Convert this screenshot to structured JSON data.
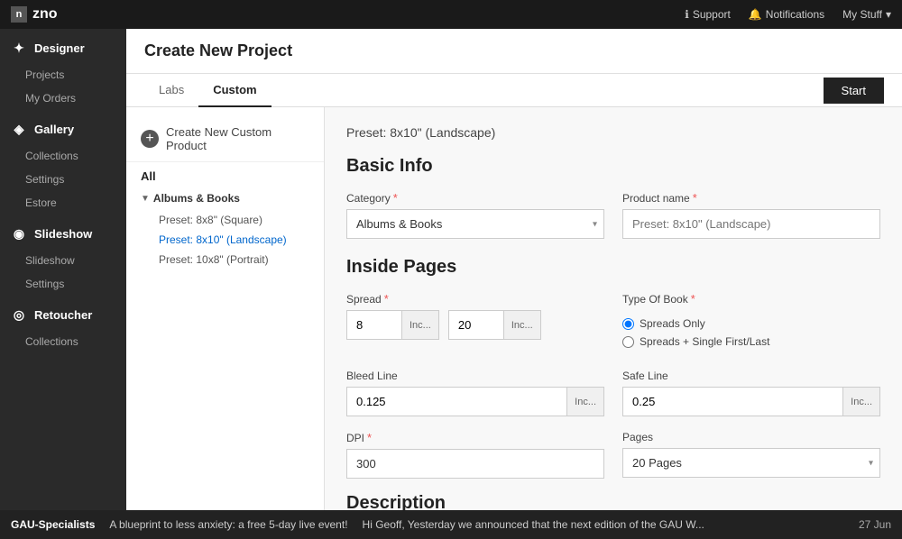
{
  "app": {
    "logo": "zno",
    "logo_prefix": "n"
  },
  "topnav": {
    "support_label": "Support",
    "notifications_label": "Notifications",
    "mystuff_label": "My Stuff"
  },
  "sidebar": {
    "sections": [
      {
        "id": "designer",
        "label": "Designer",
        "icon": "✦",
        "items": [
          "Projects",
          "My Orders"
        ]
      },
      {
        "id": "gallery",
        "label": "Gallery",
        "icon": "◈",
        "items": [
          "Collections",
          "Settings",
          "Estore"
        ]
      },
      {
        "id": "slideshow",
        "label": "Slideshow",
        "icon": "◉",
        "items": [
          "Slideshow",
          "Settings"
        ]
      },
      {
        "id": "retoucher",
        "label": "Retoucher",
        "icon": "◎",
        "items": [
          "Collections"
        ]
      }
    ]
  },
  "page": {
    "title": "Create New Project"
  },
  "tabs": {
    "items": [
      "Labs",
      "Custom"
    ],
    "active": "Custom",
    "start_button": "Start"
  },
  "left_panel": {
    "create_button": "Create New Custom Product",
    "all_label": "All",
    "tree": {
      "parent": "Albums & Books",
      "children": [
        "Preset: 8x8\" (Square)",
        "Preset: 8x10\" (Landscape)",
        "Preset: 10x8\" (Portrait)"
      ]
    }
  },
  "form": {
    "preset_label": "Preset: 8x10\" (Landscape)",
    "basic_info_title": "Basic Info",
    "category": {
      "label": "Category",
      "required": true,
      "value": "Albums & Books"
    },
    "product_name": {
      "label": "Product name",
      "required": true,
      "placeholder": "Preset: 8x10\" (Landscape)"
    },
    "inside_pages_title": "Inside Pages",
    "spread": {
      "label": "Spread",
      "required": true,
      "value1": "8",
      "unit1": "Inc...",
      "value2": "20",
      "unit2": "Inc..."
    },
    "type_of_book": {
      "label": "Type Of Book",
      "required": true,
      "options": [
        {
          "label": "Spreads Only",
          "checked": true
        },
        {
          "label": "Spreads + Single First/Last",
          "checked": false
        }
      ]
    },
    "bleed_line": {
      "label": "Bleed Line",
      "value": "0.125",
      "unit": "Inc..."
    },
    "safe_line": {
      "label": "Safe Line",
      "value": "0.25",
      "unit": "Inc..."
    },
    "dpi": {
      "label": "DPI",
      "required": true,
      "value": "300"
    },
    "pages": {
      "label": "Pages",
      "value": "20 Pages"
    },
    "description_title": "Description"
  },
  "bottom_bar": {
    "sender": "GAU-Specialists",
    "message": "A blueprint to less anxiety: a free 5-day live event!",
    "preview": "Hi Geoff, Yesterday we announced that the next edition of the GAU W...",
    "date": "27 Jun"
  }
}
